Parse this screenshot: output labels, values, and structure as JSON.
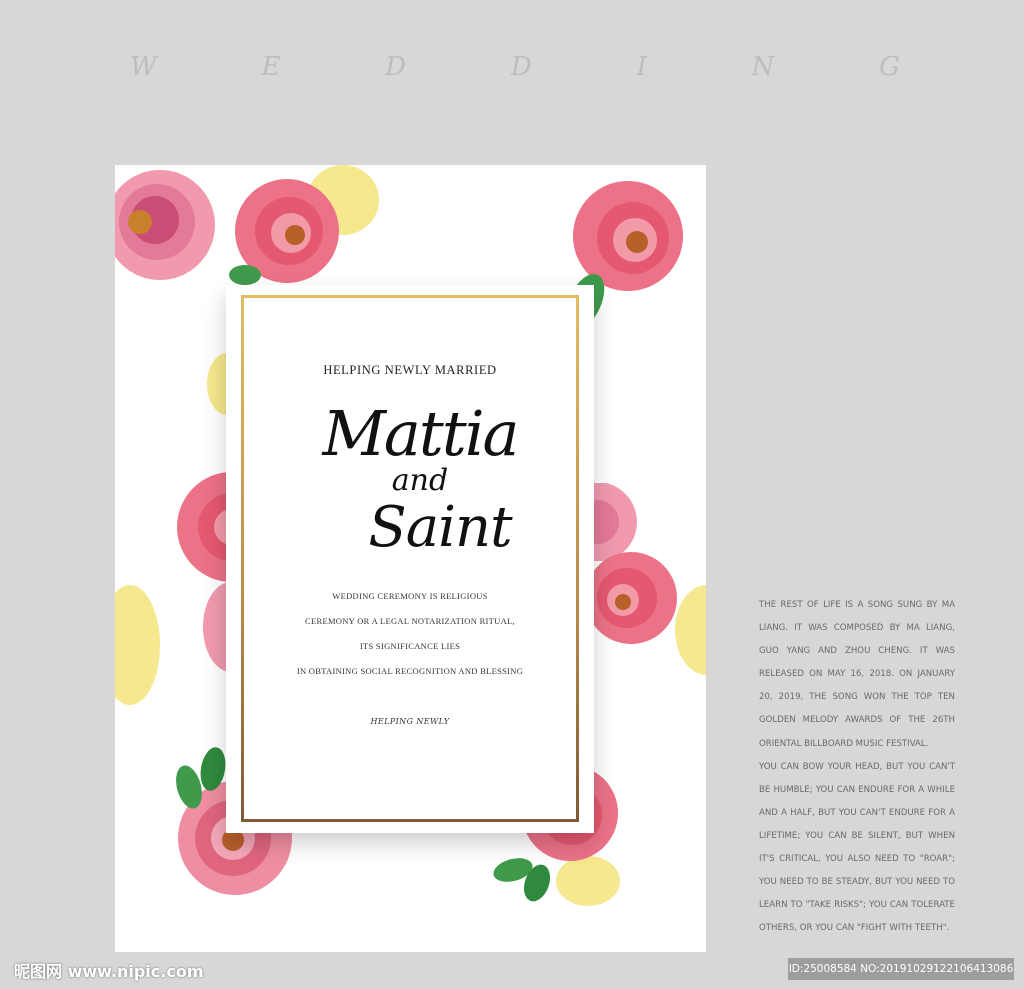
{
  "heading": {
    "letters": [
      "W",
      "E",
      "D",
      "D",
      "I",
      "N",
      "G"
    ]
  },
  "invitation": {
    "title": "HELPING NEWLY MARRIED",
    "name_first": "Mattia",
    "name_and": "and",
    "name_second": "Saint",
    "body_lines": [
      "WEDDING CEREMONY IS RELIGIOUS",
      "CEREMONY OR A LEGAL NOTARIZATION RITUAL,",
      "ITS SIGNIFICANCE LIES",
      "IN OBTAINING SOCIAL RECOGNITION AND BLESSING"
    ],
    "footer_script": "HELPING NEWLY"
  },
  "side_text": {
    "paragraph_1": "THE REST OF LIFE IS A SONG SUNG BY MA LIANG. IT WAS COMPOSED BY MA LIANG, GUO YANG AND ZHOU CHENG. IT WAS RELEASED ON MAY 16, 2018. ON JANUARY 20, 2019, THE SONG WON THE TOP TEN GOLDEN MELODY AWARDS OF THE 26TH ORIENTAL BILLBOARD MUSIC FESTIVAL.",
    "paragraph_2": "YOU CAN BOW YOUR HEAD, BUT YOU CAN'T BE HUMBLE; YOU CAN ENDURE FOR A WHILE AND A HALF, BUT YOU CAN'T ENDURE FOR A LIFETIME; YOU CAN BE SILENT, BUT WHEN IT'S CRITICAL, YOU ALSO NEED TO \"ROAR\"; YOU NEED TO BE STEADY, BUT YOU NEED TO LEARN TO \"TAKE RISKS\"; YOU CAN TOLERATE OTHERS, OR YOU CAN \"FIGHT WITH TEETH\"."
  },
  "watermark": {
    "site": "昵图网 www.nipic.com",
    "id": "ID:25008584 NO:20191029122106413086"
  },
  "colors": {
    "background": "#d7d7d7",
    "card": "#ffffff",
    "gold_frame": "#c59a52",
    "rose": "#e8687a",
    "rose_light": "#f19aae",
    "petal_yellow": "#f4e47a",
    "leaf": "#3f9a4c"
  }
}
